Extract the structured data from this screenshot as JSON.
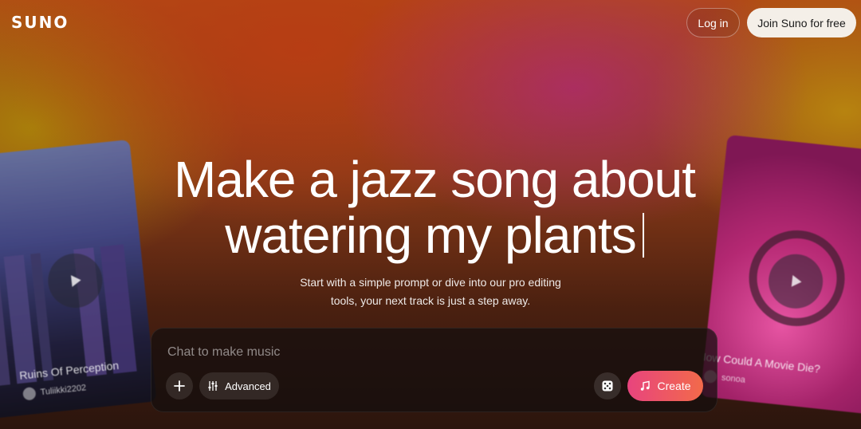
{
  "header": {
    "logo": "SUNO",
    "login_label": "Log in",
    "join_label": "Join Suno for free"
  },
  "hero": {
    "headline_line1": "Make a jazz song about",
    "headline_line2": "watering my plants",
    "subtitle_line1": "Start with a simple prompt or dive into our pro editing",
    "subtitle_line2": "tools, your next track is just a step away."
  },
  "composer": {
    "placeholder": "Chat to make music",
    "value": "",
    "add_icon": "plus-icon",
    "advanced_label": "Advanced",
    "advanced_icon": "sliders-icon",
    "dice_icon": "dice-icon",
    "create_label": "Create",
    "create_icon": "music-note-icon"
  },
  "cards": [
    {
      "title": "Ruins Of Perception",
      "user": "Tuliikki2202"
    },
    {
      "title": "How Could A Movie Die?",
      "user": "sonoa"
    }
  ],
  "colors": {
    "create_gradient_start": "#e8447e",
    "create_gradient_end": "#f26a4a",
    "join_bg": "#f4efe8"
  }
}
